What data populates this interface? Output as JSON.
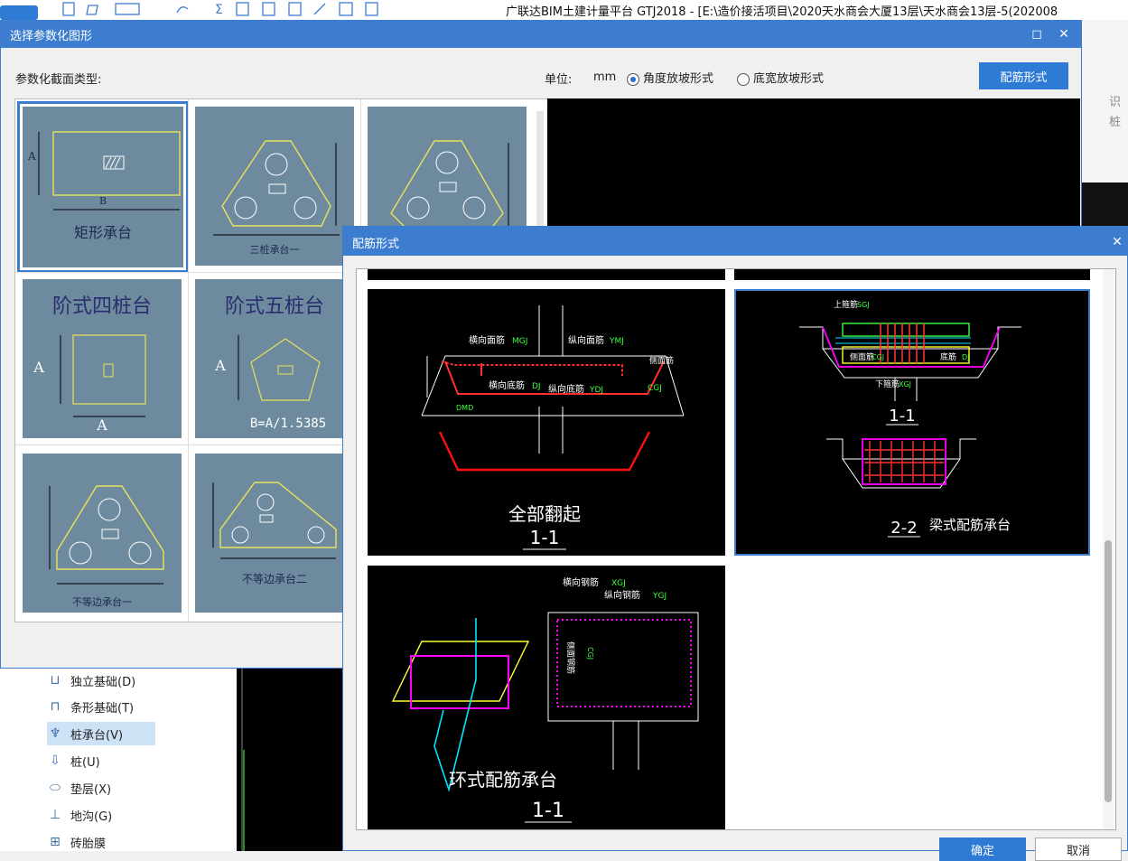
{
  "app": {
    "title": "广联达BIM土建计量平台 GTJ2018 - [E:\\造价接活项目\\2020天水商会大厦13层\\天水商会13层-5(202008"
  },
  "right_strip": {
    "text1": "识",
    "text2": "桩"
  },
  "left_tree": {
    "items": [
      {
        "label": "独立基础(D)",
        "icon": "isolated-footing-icon"
      },
      {
        "label": "条形基础(T)",
        "icon": "strip-footing-icon"
      },
      {
        "label": "桩承台(V)",
        "icon": "pile-cap-icon"
      },
      {
        "label": "桩(U)",
        "icon": "pile-icon"
      },
      {
        "label": "垫层(X)",
        "icon": "cushion-icon"
      },
      {
        "label": "地沟(G)",
        "icon": "trench-icon"
      },
      {
        "label": "砖胎膜",
        "icon": "brick-mold-icon"
      }
    ]
  },
  "dialog1": {
    "title": "选择参数化图形",
    "section_label": "参数化截面类型:",
    "unit_label": "单位:",
    "unit_value": "mm",
    "radio_angle": "角度放坡形式",
    "radio_width": "底宽放坡形式",
    "rebar_button": "配筋形式",
    "shapes": [
      {
        "caption": "矩形承台",
        "dim_a": "A",
        "dim_b": "B"
      },
      {
        "caption": "三桩承台一"
      },
      {
        "caption": ""
      },
      {
        "caption": "阶式四桩台",
        "dim_a": "A",
        "dim_b": "A"
      },
      {
        "caption": "阶式五桩台",
        "dim_a": "A",
        "dim_b": "B=A/1.5385"
      },
      {
        "caption": "不等边承台一"
      },
      {
        "caption": "不等边承台二"
      }
    ]
  },
  "dialog2": {
    "title": "配筋形式",
    "card1": {
      "title": "全部翻起",
      "section": "1-1",
      "labels": [
        "横向面筋",
        "MGJ",
        "纵向面筋",
        "YMJ",
        "横向底筋",
        "DJ",
        "纵向底筋",
        "YDJ",
        "CGJ",
        "DMD",
        "侧面筋"
      ]
    },
    "card2": {
      "title": "梁式配筋承台",
      "section1": "1-1",
      "section2": "2-2",
      "labels": [
        "上箍筋",
        "SGJ",
        "侧面筋",
        "CGJ",
        "下箍筋",
        "XGJ",
        "底筋",
        "DJ"
      ]
    },
    "card3": {
      "title": "环式配筋承台",
      "section": "1-1",
      "labels": [
        "横向钢筋",
        "XGJ",
        "纵向钢筋",
        "YGJ",
        "侧面钢筋",
        "CGJ"
      ]
    },
    "ok_button": "确定",
    "cancel_button": "取消"
  }
}
